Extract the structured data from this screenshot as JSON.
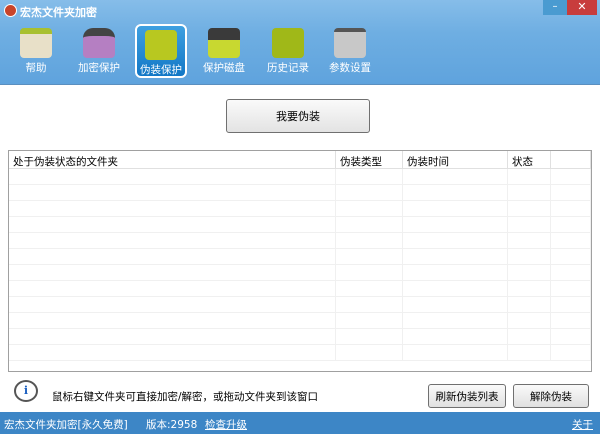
{
  "window": {
    "title": "宏杰文件夹加密",
    "minimize": "–",
    "close": "✕"
  },
  "toolbar": [
    {
      "label": "帮助",
      "icon": "home-icon",
      "color": "#e8e0c8"
    },
    {
      "label": "加密保护",
      "icon": "lock-icon",
      "color": "#b57fc2"
    },
    {
      "label": "伪装保护",
      "icon": "notebook-icon",
      "color": "#b8c820"
    },
    {
      "label": "保护磁盘",
      "icon": "floppy-disk-icon",
      "color": "#3a3a3a"
    },
    {
      "label": "历史记录",
      "icon": "history-chart-icon",
      "color": "#a0b818"
    },
    {
      "label": "参数设置",
      "icon": "toolbox-icon",
      "color": "#c8c8c8"
    }
  ],
  "main": {
    "fake_button": "我要伪装"
  },
  "table": {
    "columns": [
      "处于伪装状态的文件夹",
      "伪装类型",
      "伪装时间",
      "状态"
    ],
    "rows": []
  },
  "footer": {
    "tip": "鼠标右键文件夹可直接加密/解密，或拖动文件夹到该窗口",
    "refresh": "刷新伪装列表",
    "remove": "解除伪装",
    "info_icon": "i"
  },
  "status": {
    "product": "宏杰文件夹加密[永久免费]",
    "version": "版本:2958",
    "check": "检查升级",
    "about": "关于"
  }
}
